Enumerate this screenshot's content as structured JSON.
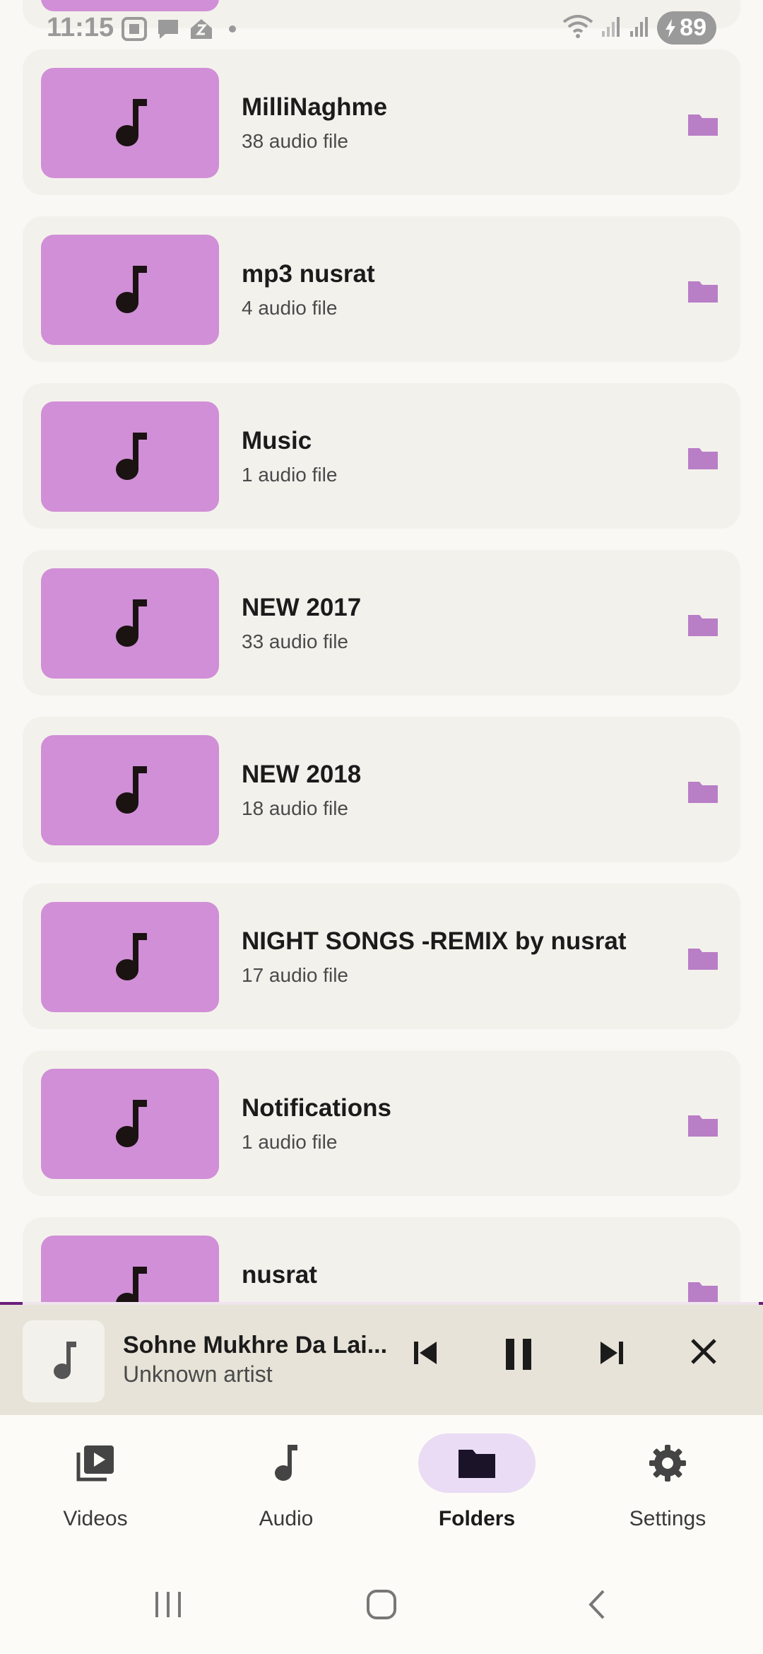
{
  "status_bar": {
    "time": "11:15",
    "battery": "89"
  },
  "folders": [
    {
      "name": "",
      "count": ""
    },
    {
      "name": "MilliNaghme",
      "count": "38 audio file"
    },
    {
      "name": "mp3 nusrat",
      "count": "4 audio file"
    },
    {
      "name": "Music",
      "count": "1 audio file"
    },
    {
      "name": "NEW 2017",
      "count": "33 audio file"
    },
    {
      "name": "NEW 2018",
      "count": "18 audio file"
    },
    {
      "name": "NIGHT SONGS -REMIX by nusrat",
      "count": "17 audio file"
    },
    {
      "name": "Notifications",
      "count": "1 audio file"
    },
    {
      "name": "nusrat",
      "count": ""
    }
  ],
  "player": {
    "title": "Sohne Mukhre Da Lai...",
    "artist": "Unknown artist",
    "progress": 0.03
  },
  "nav": {
    "items": [
      {
        "label": "Videos",
        "icon": "video-library-icon"
      },
      {
        "label": "Audio",
        "icon": "music-note-icon"
      },
      {
        "label": "Folders",
        "icon": "folder-icon",
        "active": true
      },
      {
        "label": "Settings",
        "icon": "gear-icon"
      }
    ]
  },
  "colors": {
    "thumb": "#d08fd6",
    "folder_icon": "#b87ec6",
    "active_nav": "#e9dcf4",
    "accent": "#6b1f7a"
  }
}
